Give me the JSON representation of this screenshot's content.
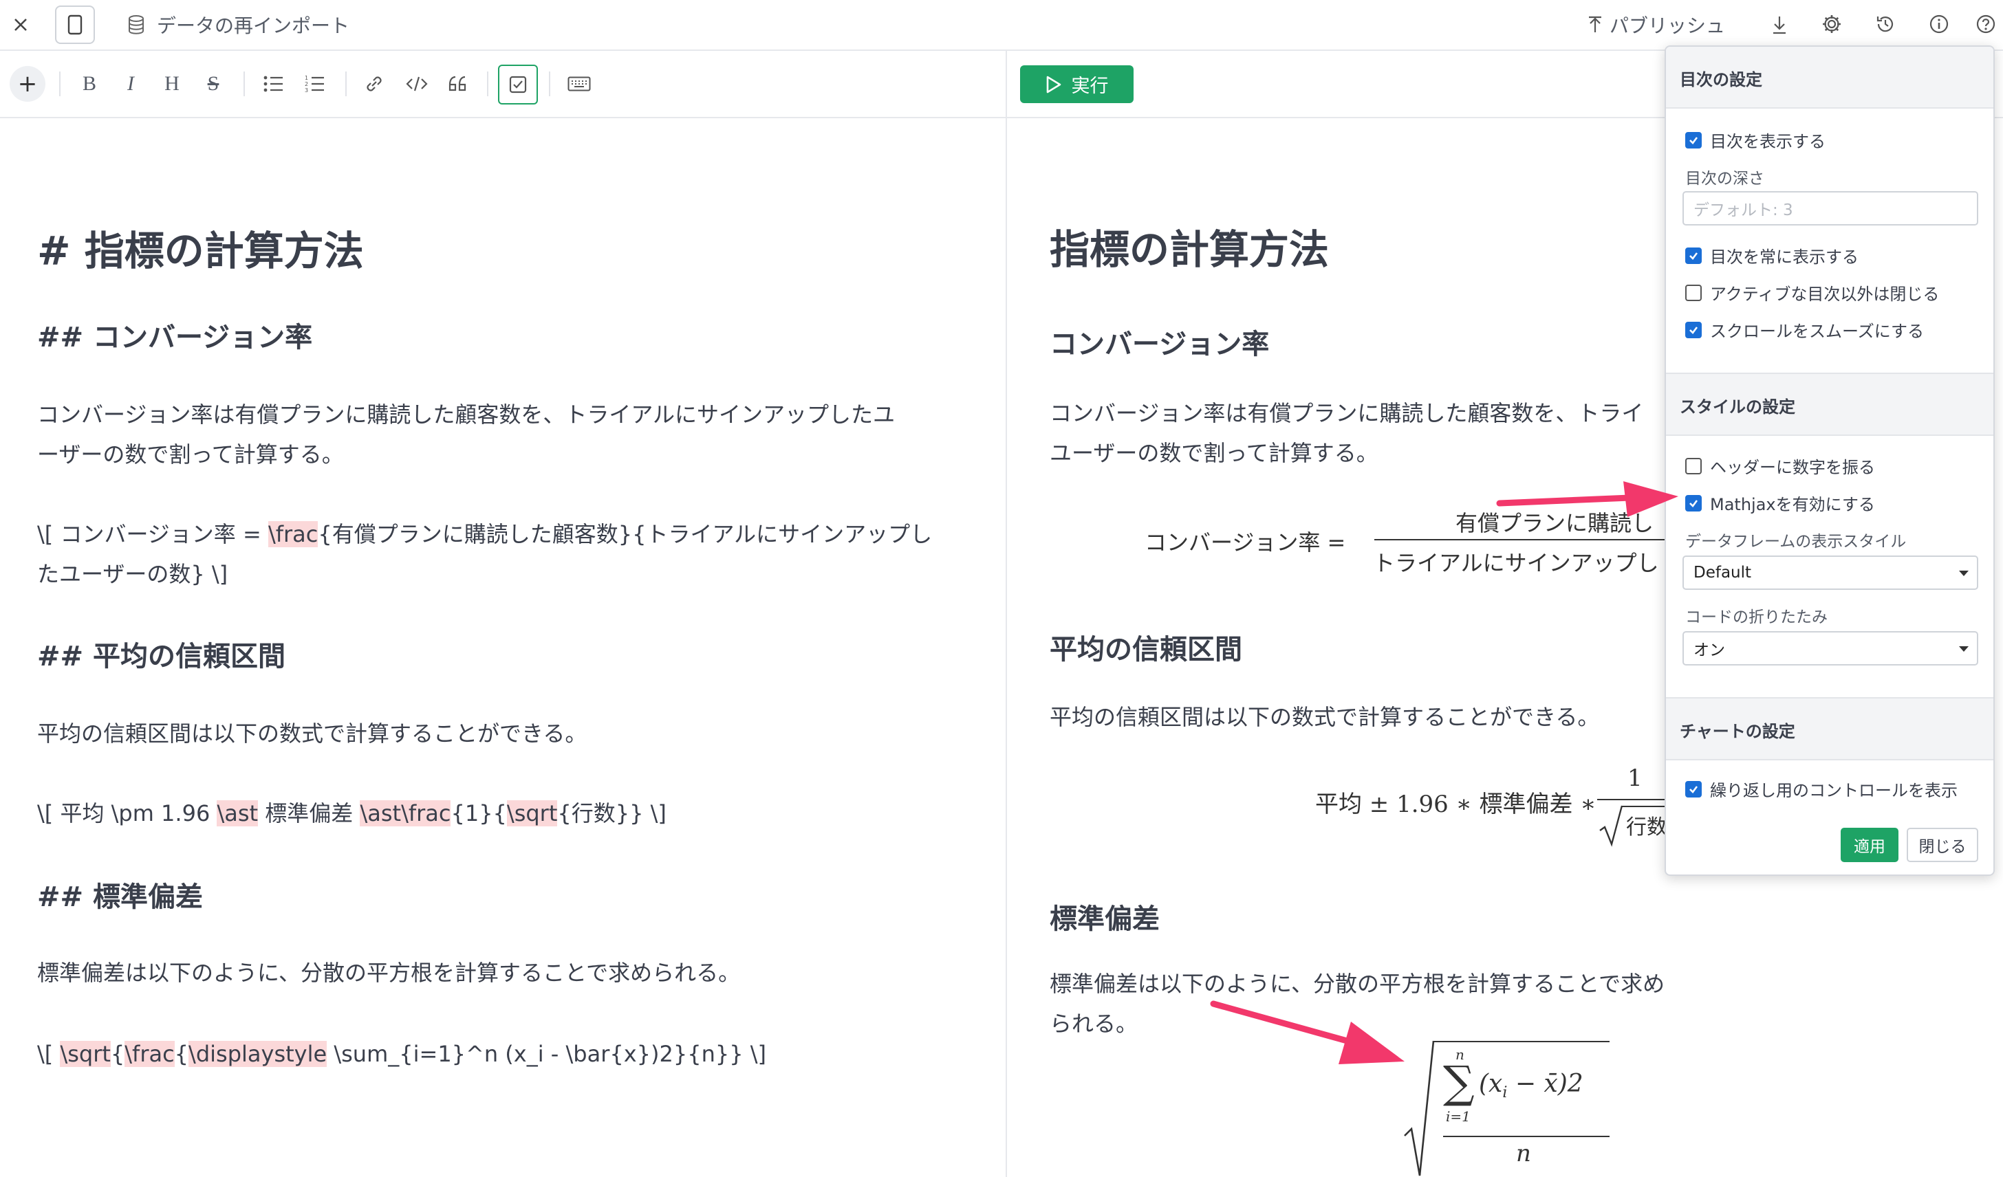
{
  "topbar": {
    "doc_title": "データの再インポート",
    "publish_label": "パブリッシュ",
    "icons": [
      "close-icon",
      "panel-toggle-icon",
      "database-icon",
      "upload-icon",
      "download-icon",
      "gear-icon",
      "history-icon",
      "info-icon",
      "help-icon"
    ]
  },
  "toolbar": {
    "buttons": [
      "add",
      "bold",
      "italic",
      "heading",
      "strikethrough",
      "bullet-list",
      "numbered-list",
      "link",
      "code",
      "quote",
      "checkbox",
      "keyboard"
    ],
    "bold": "B",
    "italic": "I",
    "heading": "H",
    "strike": "S"
  },
  "run": {
    "label": "実行"
  },
  "editor": {
    "h1": "# 指標の計算方法",
    "h2_conversion": "## コンバージョン率",
    "p_conversion_1": "コンバージョン率は有償プランに購読した顧客数を、トライアルにサインアップしたユ",
    "p_conversion_2": "ーザーの数で割って計算する。",
    "math1_a": "\\[ コンバージョン率 = ",
    "math1_b": "\\frac",
    "math1_c": "{有償プランに購読した顧客数}{トライアルにサインアップし",
    "math1_d": "たユーザーの数} \\]",
    "h2_ci": "## 平均の信頼区間",
    "p_ci": "平均の信頼区間は以下の数式で計算することができる。",
    "math2_a": "\\[ 平均 \\pm 1.96 ",
    "math2_b": "\\ast",
    "math2_c": " 標準偏差 ",
    "math2_d": "\\ast",
    "math2_e": "\\frac",
    "math2_f": "{1}{",
    "math2_g": "\\sqrt",
    "math2_h": "{行数}} \\]",
    "h2_sd": "## 標準偏差",
    "p_sd": "標準偏差は以下のように、分散の平方根を計算することで求められる。",
    "math3_a": "\\[ ",
    "math3_b": "\\sqrt",
    "math3_c": "{",
    "math3_d": "\\frac",
    "math3_e": "{",
    "math3_f": "\\displaystyle",
    "math3_g": " \\sum_{i=1}^n (x_i - \\bar{x})2}{n}} \\]"
  },
  "preview": {
    "h1": "指標の計算方法",
    "h2_conversion": "コンバージョン率",
    "p_conversion_1": "コンバージョン率は有償プランに購読した顧客数を、トライ",
    "p_conversion_2": "ユーザーの数で割って計算する。",
    "math1_lhs": "コンバージョン率 =",
    "math1_num": "有償プランに購読し",
    "math1_den": "トライアルにサインアップし",
    "h2_ci": "平均の信頼区間",
    "p_ci": "平均の信頼区間は以下の数式で計算することができる。",
    "math2_lhs": "平均 ± 1.96 ∗ 標準偏差 ∗",
    "math2_num": "1",
    "math2_den": "行数",
    "h2_sd": "標準偏差",
    "p_sd": "標準偏差は以下のように、分散の平方根を計算することで求められる。",
    "math3_sum": "∑",
    "math3_top": "n",
    "math3_bottom": "i=1",
    "math3_body": "(x",
    "math3_sub": "i",
    "math3_rest": " − x̄)2",
    "math3_den": "n"
  },
  "settings": {
    "toc_title": "目次の設定",
    "toc_show": "目次を表示する",
    "toc_depth_label": "目次の深さ",
    "toc_depth_placeholder": "デフォルト: 3",
    "toc_always": "目次を常に表示する",
    "toc_close_inactive": "アクティブな目次以外は閉じる",
    "toc_smooth": "スクロールをスムーズにする",
    "style_title": "スタイルの設定",
    "style_numbering": "ヘッダーに数字を振る",
    "style_mathjax": "Mathjaxを有効にする",
    "style_df_label": "データフレームの表示スタイル",
    "style_df_value": "Default",
    "style_fold_label": "コードの折りたたみ",
    "style_fold_value": "オン",
    "chart_title": "チャートの設定",
    "chart_controls": "繰り返し用のコントロールを表示",
    "apply": "適用",
    "close": "閉じる",
    "checked": {
      "toc_show": true,
      "toc_always": true,
      "toc_close_inactive": false,
      "toc_smooth": true,
      "style_numbering": false,
      "style_mathjax": true,
      "chart_controls": true
    }
  },
  "colors": {
    "accent_green": "#1ea365",
    "checkbox_blue": "#1a6ed6",
    "arrow_pink": "#f2386b",
    "highlight": "#fbd8d9"
  }
}
